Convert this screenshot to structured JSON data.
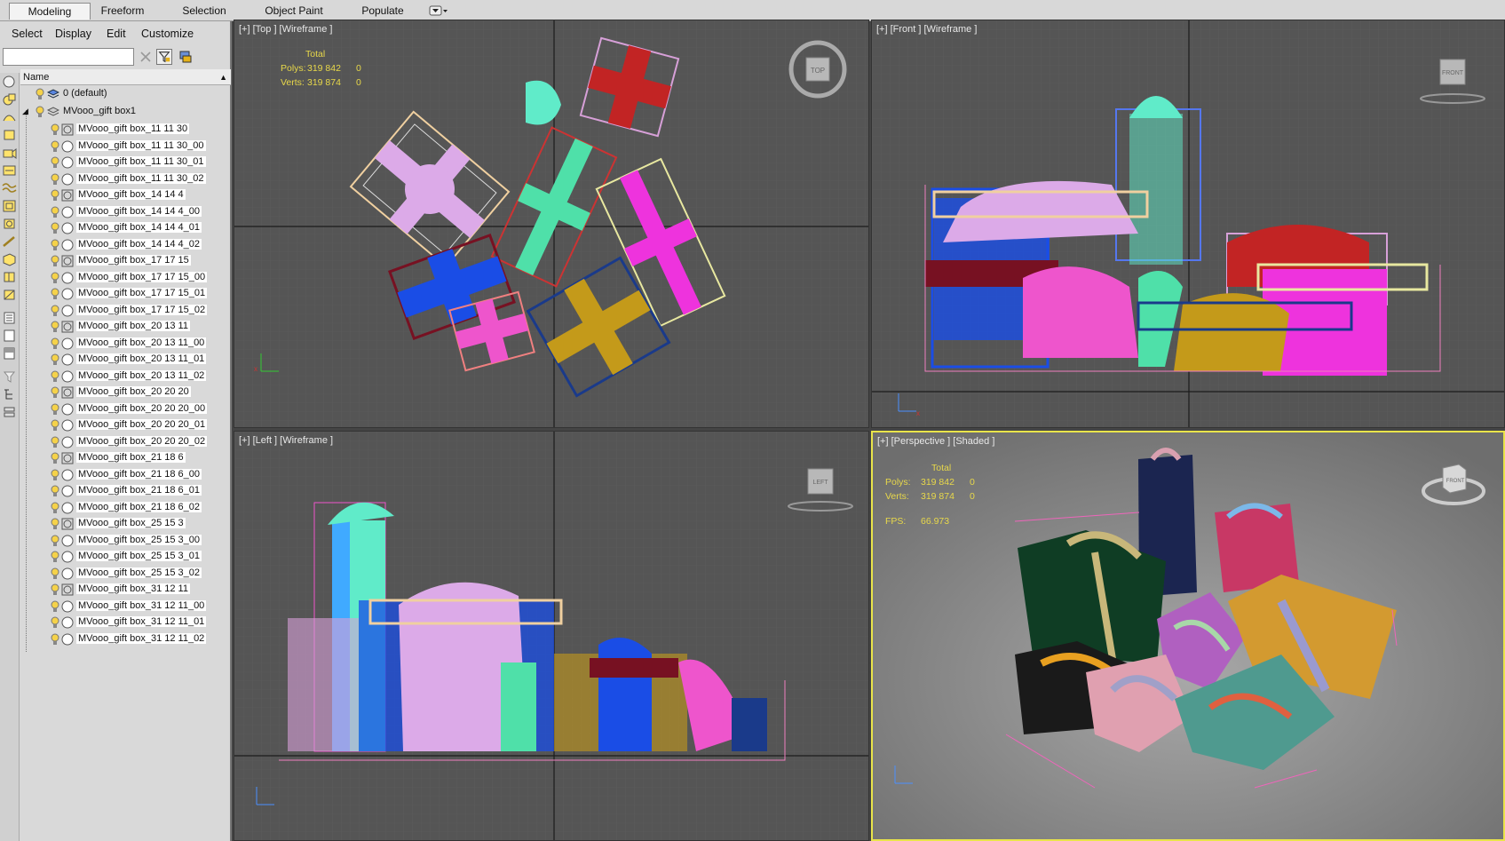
{
  "ribbon": {
    "tabs": [
      "Modeling",
      "Freeform",
      "Selection",
      "Object Paint",
      "Populate"
    ],
    "active_tab": "Modeling"
  },
  "explorer": {
    "menu": [
      "Select",
      "Display",
      "Edit",
      "Customize"
    ],
    "search_value": "",
    "column_header": "Name",
    "layers": [
      {
        "label": "0 (default)"
      },
      {
        "label": "MVooo_gift box1"
      }
    ],
    "objects": [
      "MVooo_gift box_11 11 30",
      "MVooo_gift box_11 11 30_00",
      "MVooo_gift box_11 11 30_01",
      "MVooo_gift box_11 11 30_02",
      "MVooo_gift box_14 14 4",
      "MVooo_gift box_14 14 4_00",
      "MVooo_gift box_14 14 4_01",
      "MVooo_gift box_14 14 4_02",
      "MVooo_gift box_17 17 15",
      "MVooo_gift box_17 17 15_00",
      "MVooo_gift box_17 17 15_01",
      "MVooo_gift box_17 17 15_02",
      "MVooo_gift box_20 13 11",
      "MVooo_gift box_20 13 11_00",
      "MVooo_gift box_20 13 11_01",
      "MVooo_gift box_20 13 11_02",
      "MVooo_gift box_20 20 20",
      "MVooo_gift box_20 20 20_00",
      "MVooo_gift box_20 20 20_01",
      "MVooo_gift box_20 20 20_02",
      "MVooo_gift box_21 18 6",
      "MVooo_gift box_21 18 6_00",
      "MVooo_gift box_21 18 6_01",
      "MVooo_gift box_21 18 6_02",
      "MVooo_gift box_25 15 3",
      "MVooo_gift box_25 15 3_00",
      "MVooo_gift box_25 15 3_01",
      "MVooo_gift box_25 15 3_02",
      "MVooo_gift box_31 12 11",
      "MVooo_gift box_31 12 11_00",
      "MVooo_gift box_31 12 11_01",
      "MVooo_gift box_31 12 11_02"
    ]
  },
  "viewports": {
    "top": {
      "label": "[+] [Top ] [Wireframe ]",
      "cube": "TOP"
    },
    "front": {
      "label": "[+] [Front ] [Wireframe ]",
      "cube": "FRONT"
    },
    "left": {
      "label": "[+] [Left ] [Wireframe ]",
      "cube": "LEFT"
    },
    "perspective": {
      "label": "[+] [Perspective ] [Shaded ]",
      "cube": "FRONT"
    }
  },
  "stats": {
    "total_label": "Total",
    "polys_label": "Polys:",
    "polys_value": "319 842",
    "polys_sel": "0",
    "verts_label": "Verts:",
    "verts_value": "319 874",
    "verts_sel": "0",
    "fps_label": "FPS:",
    "fps_value": "66.973"
  },
  "colors": {
    "active_viewport_border": "#e9e44a",
    "stats_text": "#e8d84a",
    "viewport_bg": "#555555",
    "perspective_bg": "#8c8c8c"
  }
}
